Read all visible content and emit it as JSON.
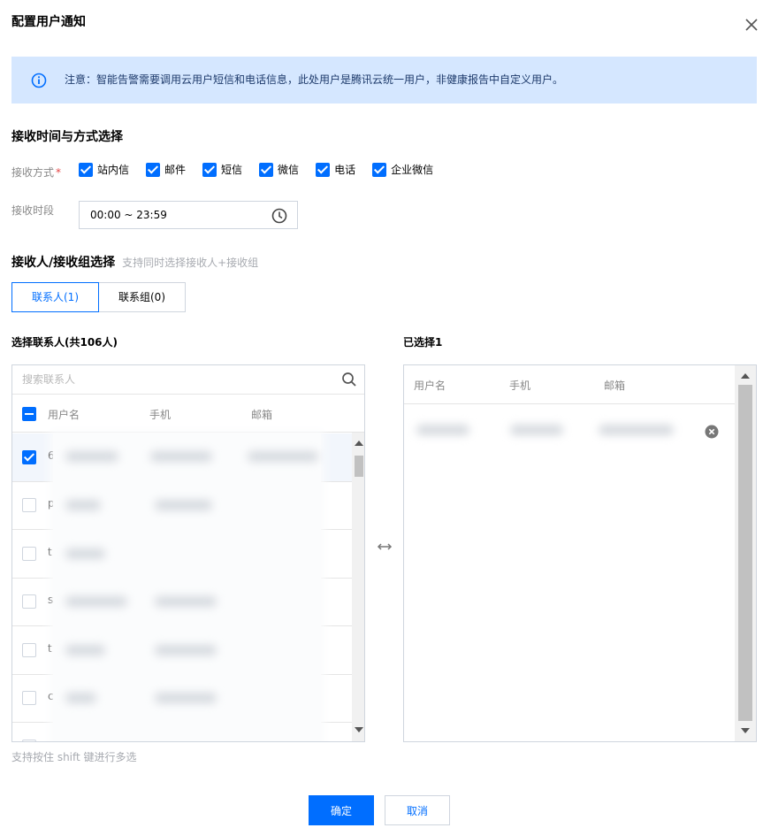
{
  "dialog": {
    "title": "配置用户通知"
  },
  "notice": {
    "text": "注意：智能告警需要调用云用户短信和电话信息，此处用户是腾讯云统一用户，非健康报告中自定义用户。"
  },
  "receive_section": {
    "title": "接收时间与方式选择",
    "method_label": "接收方式",
    "required_mark": "*",
    "methods": [
      {
        "label": "站内信",
        "checked": true
      },
      {
        "label": "邮件",
        "checked": true
      },
      {
        "label": "短信",
        "checked": true
      },
      {
        "label": "微信",
        "checked": true
      },
      {
        "label": "电话",
        "checked": true
      },
      {
        "label": "企业微信",
        "checked": true
      }
    ],
    "period_label": "接收时段",
    "period_value": "00:00 ~ 23:59"
  },
  "recipient_section": {
    "title": "接收人/接收组选择",
    "hint": "支持同时选择接收人+接收组",
    "tabs": [
      {
        "label": "联系人(1)",
        "active": true
      },
      {
        "label": "联系组(0)",
        "active": false
      }
    ]
  },
  "left_panel": {
    "title": "选择联系人(共106人)",
    "search_placeholder": "搜索联系人",
    "columns": [
      "用户名",
      "手机",
      "邮箱"
    ],
    "rows": [
      {
        "first_char": "6",
        "checked": true
      },
      {
        "first_char": "p",
        "checked": false
      },
      {
        "first_char": "t",
        "checked": false
      },
      {
        "first_char": "s",
        "checked": false
      },
      {
        "first_char": "t",
        "checked": false
      },
      {
        "first_char": "c",
        "checked": false
      }
    ]
  },
  "right_panel": {
    "title": "已选择1",
    "columns": [
      "用户名",
      "手机",
      "邮箱"
    ]
  },
  "footer": {
    "shift_hint": "支持按住 shift 键进行多选",
    "confirm_label": "确定",
    "cancel_label": "取消"
  },
  "colors": {
    "primary": "#006eff",
    "notice_bg": "#d5e7ff",
    "required": "#e54545"
  }
}
